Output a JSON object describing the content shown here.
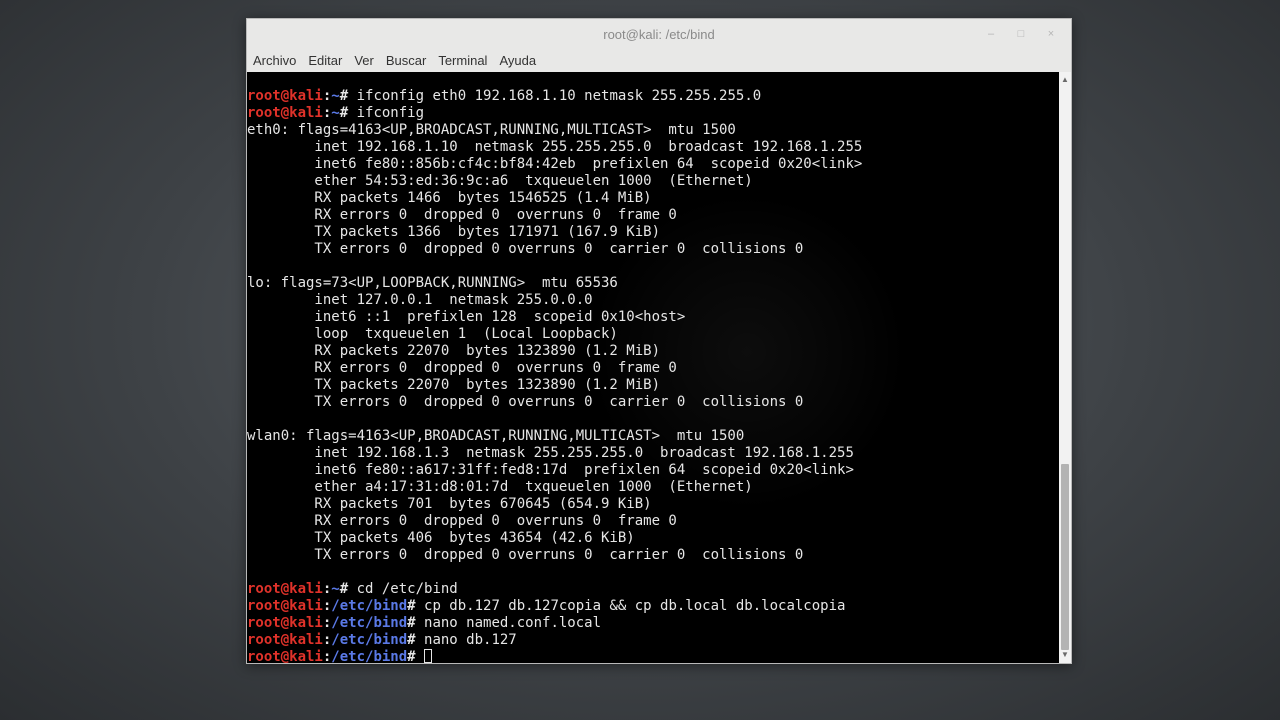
{
  "window": {
    "title": "root@kali: /etc/bind",
    "buttons": {
      "minimize": "–",
      "maximize": "□",
      "close": "×"
    }
  },
  "menu": [
    "Archivo",
    "Editar",
    "Ver",
    "Buscar",
    "Terminal",
    "Ayuda"
  ],
  "prompt": {
    "user": "root@kali",
    "home_path": "~",
    "bind_path": "/etc/bind",
    "symbol": "# ",
    "separator": ":"
  },
  "terminal_lines": [
    {
      "type": "cmd",
      "path": "~",
      "text": "ifconfig eth0 192.168.1.10 netmask 255.255.255.0"
    },
    {
      "type": "cmd",
      "path": "~",
      "text": "ifconfig"
    },
    {
      "type": "out",
      "text": "eth0: flags=4163<UP,BROADCAST,RUNNING,MULTICAST>  mtu 1500"
    },
    {
      "type": "out",
      "text": "        inet 192.168.1.10  netmask 255.255.255.0  broadcast 192.168.1.255"
    },
    {
      "type": "out",
      "text": "        inet6 fe80::856b:cf4c:bf84:42eb  prefixlen 64  scopeid 0x20<link>"
    },
    {
      "type": "out",
      "text": "        ether 54:53:ed:36:9c:a6  txqueuelen 1000  (Ethernet)"
    },
    {
      "type": "out",
      "text": "        RX packets 1466  bytes 1546525 (1.4 MiB)"
    },
    {
      "type": "out",
      "text": "        RX errors 0  dropped 0  overruns 0  frame 0"
    },
    {
      "type": "out",
      "text": "        TX packets 1366  bytes 171971 (167.9 KiB)"
    },
    {
      "type": "out",
      "text": "        TX errors 0  dropped 0 overruns 0  carrier 0  collisions 0"
    },
    {
      "type": "out",
      "text": ""
    },
    {
      "type": "out",
      "text": "lo: flags=73<UP,LOOPBACK,RUNNING>  mtu 65536"
    },
    {
      "type": "out",
      "text": "        inet 127.0.0.1  netmask 255.0.0.0"
    },
    {
      "type": "out",
      "text": "        inet6 ::1  prefixlen 128  scopeid 0x10<host>"
    },
    {
      "type": "out",
      "text": "        loop  txqueuelen 1  (Local Loopback)"
    },
    {
      "type": "out",
      "text": "        RX packets 22070  bytes 1323890 (1.2 MiB)"
    },
    {
      "type": "out",
      "text": "        RX errors 0  dropped 0  overruns 0  frame 0"
    },
    {
      "type": "out",
      "text": "        TX packets 22070  bytes 1323890 (1.2 MiB)"
    },
    {
      "type": "out",
      "text": "        TX errors 0  dropped 0 overruns 0  carrier 0  collisions 0"
    },
    {
      "type": "out",
      "text": ""
    },
    {
      "type": "out",
      "text": "wlan0: flags=4163<UP,BROADCAST,RUNNING,MULTICAST>  mtu 1500"
    },
    {
      "type": "out",
      "text": "        inet 192.168.1.3  netmask 255.255.255.0  broadcast 192.168.1.255"
    },
    {
      "type": "out",
      "text": "        inet6 fe80::a617:31ff:fed8:17d  prefixlen 64  scopeid 0x20<link>"
    },
    {
      "type": "out",
      "text": "        ether a4:17:31:d8:01:7d  txqueuelen 1000  (Ethernet)"
    },
    {
      "type": "out",
      "text": "        RX packets 701  bytes 670645 (654.9 KiB)"
    },
    {
      "type": "out",
      "text": "        RX errors 0  dropped 0  overruns 0  frame 0"
    },
    {
      "type": "out",
      "text": "        TX packets 406  bytes 43654 (42.6 KiB)"
    },
    {
      "type": "out",
      "text": "        TX errors 0  dropped 0 overruns 0  carrier 0  collisions 0"
    },
    {
      "type": "out",
      "text": ""
    },
    {
      "type": "cmd",
      "path": "~",
      "text": "cd /etc/bind"
    },
    {
      "type": "cmd",
      "path": "/etc/bind",
      "text": "cp db.127 db.127copia && cp db.local db.localcopia"
    },
    {
      "type": "cmd",
      "path": "/etc/bind",
      "text": "nano named.conf.local"
    },
    {
      "type": "cmd",
      "path": "/etc/bind",
      "text": "nano db.127"
    },
    {
      "type": "cmd",
      "path": "/etc/bind",
      "text": "",
      "cursor": true
    }
  ],
  "colors": {
    "prompt_user": "#e0322a",
    "prompt_path": "#5a79e6",
    "terminal_bg": "#000000",
    "terminal_fg": "#e6e6e6"
  }
}
